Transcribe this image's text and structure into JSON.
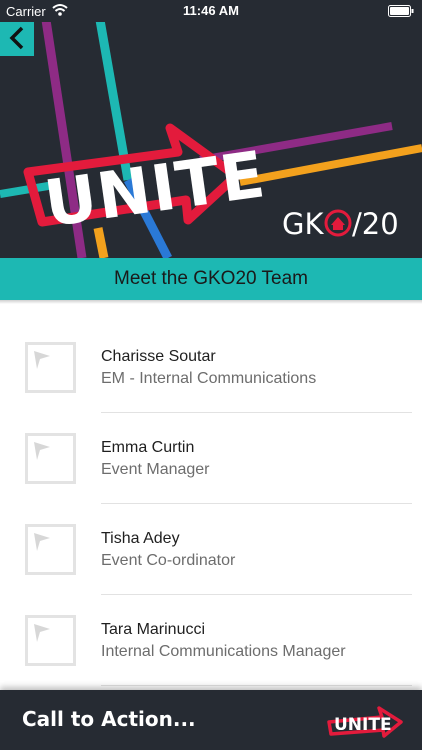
{
  "status_bar": {
    "carrier": "Carrier",
    "time": "11:46 AM"
  },
  "hero": {
    "logo_text": "UNITE",
    "brand_text_left": "GK",
    "brand_text_right": "/20",
    "background_color": "#262b33",
    "accent_color": "#1db8b3",
    "arrow_color": "#e31b3c"
  },
  "title_bar": {
    "title": "Meet the GKO20 Team"
  },
  "team": [
    {
      "name": "Charisse Soutar",
      "role": "EM - Internal Communications"
    },
    {
      "name": "Emma Curtin",
      "role": "Event Manager"
    },
    {
      "name": "Tisha Adey",
      "role": "Event Co-ordinator"
    },
    {
      "name": "Tara Marinucci",
      "role": "Internal Communications Manager"
    }
  ],
  "footer": {
    "cta_label": "Call to Action...",
    "logo_text": "UNITE"
  },
  "icons": {
    "back": "chevron-left-icon",
    "wifi": "wifi-icon",
    "battery": "battery-icon",
    "avatar_placeholder": "image-placeholder-icon",
    "home": "home-icon"
  }
}
